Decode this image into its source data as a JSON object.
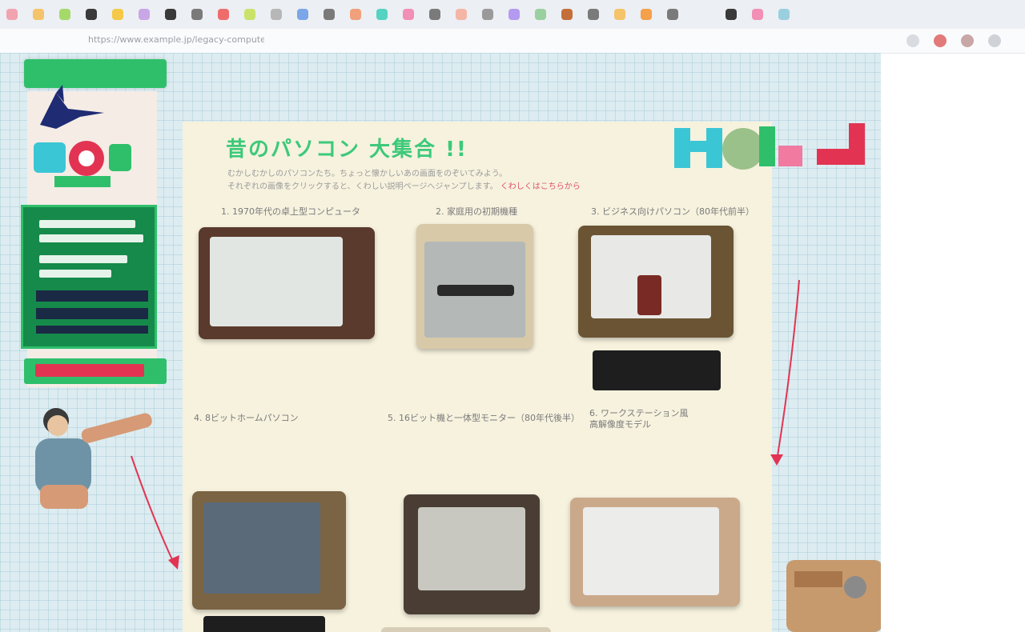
{
  "browser": {
    "url": "https://www.example.jp/legacy-computers/index.html",
    "tab_colors": [
      "#f1a3b0",
      "#f5c36a",
      "#a5d96a",
      "#3a3a3a",
      "#f5c947",
      "#c9a6e6",
      "#3a3a3a",
      "#7a7a7a",
      "#ef6c6c",
      "#c9e36a",
      "#b7b7b7",
      "#7ba6e8",
      "#7a7a7a",
      "#f0a07a",
      "#55d3c2",
      "#f28fb4",
      "#7a7a7a",
      "#f5b5a5",
      "#9a9a9a",
      "#b49af0",
      "#9acfa0",
      "#c46f3a",
      "#7a7a7a",
      "#f5c36a",
      "#f5a04a",
      "#7a7a7a",
      "#3a3a3a",
      "#f28fb4",
      "#9acfe0"
    ]
  },
  "sidebar": {
    "accent": "#2fbf6b",
    "menu_green": "#168a4a",
    "cta_red": "#e23452"
  },
  "main": {
    "title": "昔のパソコン 大集合 !!",
    "intro_line1": "むかしむかしのパソコンたち。ちょっと懐かしいあの画面をのぞいてみよう。",
    "intro_line2": "それぞれの画像をクリックすると、くわしい説明ページへジャンプします。",
    "intro_link": "くわしくはこちらから",
    "items": [
      {
        "label": "1. 1970年代の卓上型コンピュータ"
      },
      {
        "label": "2. 家庭用の初期機種"
      },
      {
        "label": "3. ビジネス向けパソコン（80年代前半）"
      },
      {
        "label": "4. 8ビットホームパソコン"
      },
      {
        "label": "5. 16ビット機と一体型モニター（80年代後半）"
      },
      {
        "label": "6. ワークステーション風\n高解像度モデル"
      }
    ]
  },
  "colors": {
    "grid_bg": "#dcecf1",
    "card_bg": "#f6f2de",
    "title_green": "#3dc97a",
    "link_pink": "#e2506a"
  }
}
